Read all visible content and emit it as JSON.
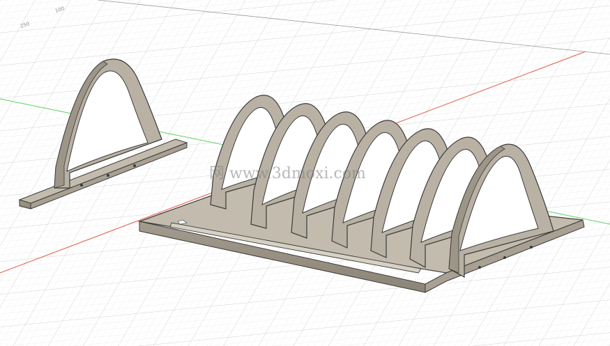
{
  "viewport": {
    "background": "#ffffff",
    "grid_minor_color": "#e6e6e6",
    "grid_major_color": "#cfcfcf",
    "axis_x_color": "#e05a4a",
    "axis_y_color": "#5fcf5f",
    "tick_labels": [
      "100",
      "250"
    ]
  },
  "model": {
    "material_color": "#b9b1a3",
    "edge_color": "#3a3a3a",
    "single_rib_icon": "arch-rib-part",
    "rack_icon": "dish-rack-assembly"
  },
  "watermark": {
    "text": "网 www.3dmoxi.com"
  }
}
